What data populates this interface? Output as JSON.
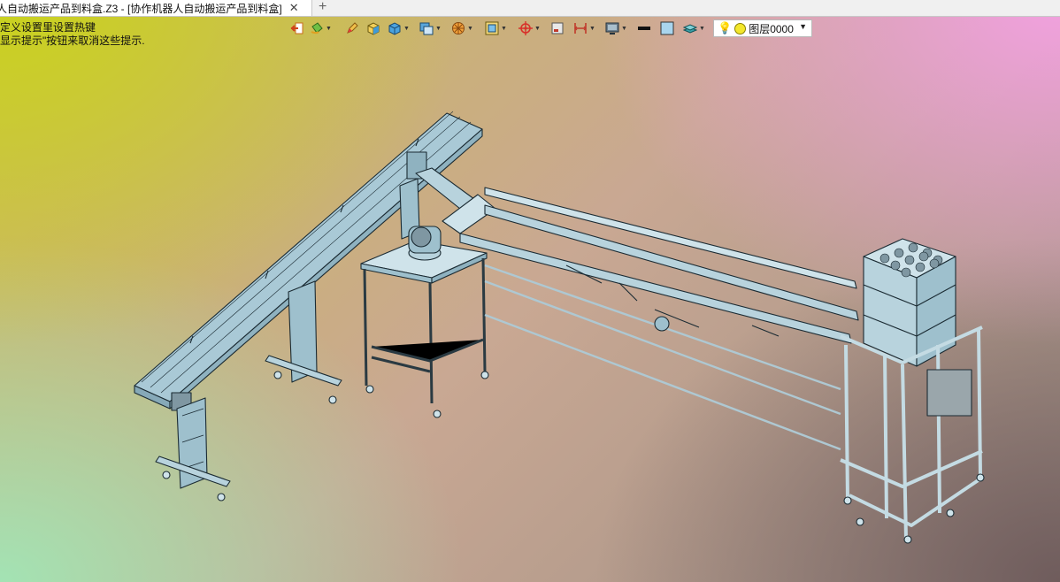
{
  "tab": {
    "title": "人自动搬运产品到料盒.Z3 - [协作机器人自动搬运产品到料盒]",
    "close_icon": "close-icon",
    "new_tab_label": "+"
  },
  "hint": {
    "line1": "定义设置里设置热键",
    "line2": "显示提示\"按钮来取消这些提示."
  },
  "toolbar": {
    "icons": [
      "exit-icon",
      "paint-bucket-icon",
      "pencil-icon",
      "cube-yellow-icon",
      "cube-blue-icon",
      "display-mode-icon",
      "render-icon",
      "view-frame-icon",
      "target-icon",
      "sheet-icon",
      "dimension-icon",
      "monitor-icon",
      "line-color-icon",
      "fill-color-icon",
      "layer-stack-icon"
    ],
    "colors": {
      "line_color": "#111111",
      "fill_color": "#a9d5ee"
    }
  },
  "layer": {
    "name": "图层0000",
    "bulb_icon": "bulb-icon",
    "status_color": "#f3e72c"
  },
  "colors": {
    "model_stroke": "#1b2b33",
    "model_fill": "#a9c9d6",
    "model_fill_light": "#cfe3ea"
  }
}
